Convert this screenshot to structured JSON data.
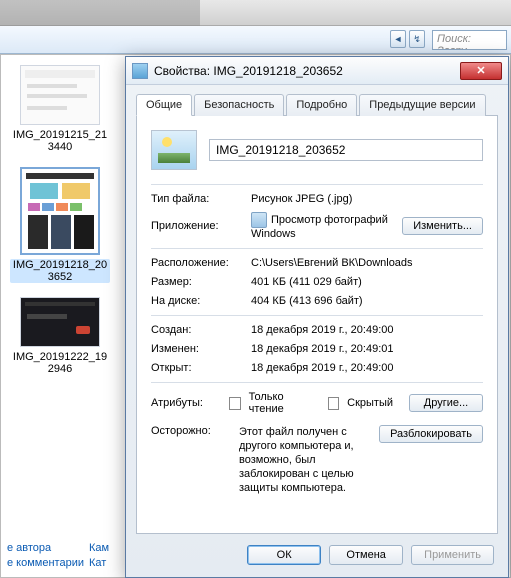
{
  "toolbar": {
    "search_placeholder": "Поиск: Загру"
  },
  "thumbs": [
    {
      "label": "IMG_20191215_213440"
    },
    {
      "label": "IMG_20191218_203652"
    },
    {
      "label": "IMG_20191222_192946"
    }
  ],
  "bottom_links": {
    "author": "е автора",
    "cam": "Кам",
    "comments": "е комментарии",
    "cam2": "Кат"
  },
  "dialog": {
    "title": "Свойства: IMG_20191218_203652",
    "tabs": {
      "general": "Общие",
      "security": "Безопасность",
      "details": "Подробно",
      "prev": "Предыдущие версии"
    },
    "filename": "IMG_20191218_203652",
    "rows": {
      "type_lbl": "Тип файла:",
      "type_val": "Рисунок JPEG (.jpg)",
      "app_lbl": "Приложение:",
      "app_val": "Просмотр фотографий Windows",
      "change_btn": "Изменить...",
      "loc_lbl": "Расположение:",
      "loc_val": "C:\\Users\\Евгений ВК\\Downloads",
      "size_lbl": "Размер:",
      "size_val": "401 КБ (411 029 байт)",
      "disk_lbl": "На диске:",
      "disk_val": "404 КБ (413 696 байт)",
      "created_lbl": "Создан:",
      "created_val": "18 декабря 2019 г., 20:49:00",
      "modified_lbl": "Изменен:",
      "modified_val": "18 декабря 2019 г., 20:49:01",
      "opened_lbl": "Открыт:",
      "opened_val": "18 декабря 2019 г., 20:49:00",
      "attr_lbl": "Атрибуты:",
      "readonly": "Только чтение",
      "hidden": "Скрытый",
      "other_btn": "Другие...",
      "warn_lbl": "Осторожно:",
      "warn_val": "Этот файл получен с другого компьютера и, возможно, был заблокирован с целью защиты компьютера.",
      "unblock_btn": "Разблокировать"
    },
    "buttons": {
      "ok": "ОК",
      "cancel": "Отмена",
      "apply": "Применить"
    }
  }
}
